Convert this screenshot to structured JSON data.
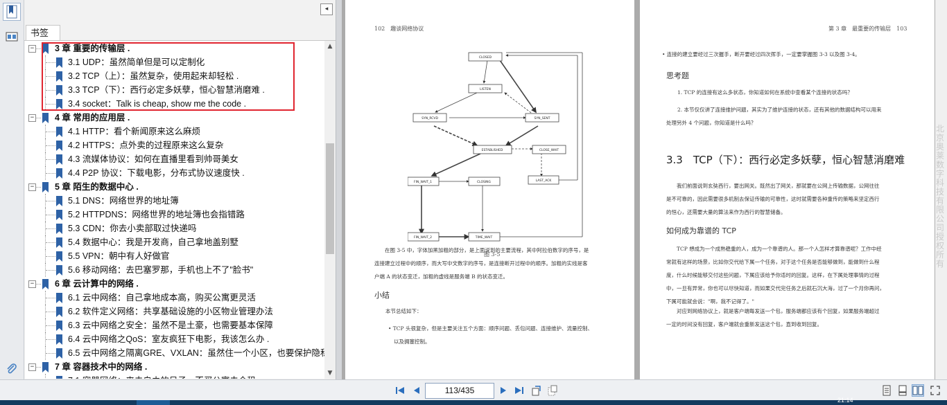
{
  "sidebar": {
    "tab_label": "书签",
    "collapse_glyph": "◂",
    "icons": [
      "bookmark-panel-icon",
      "thumbnail-panel-icon",
      "attachment-icon"
    ]
  },
  "toc": [
    {
      "level": 0,
      "label": "3 章 重要的传输层 ."
    },
    {
      "level": 1,
      "label": "3.1 UDP：虽然简单但是可以定制化"
    },
    {
      "level": 1,
      "label": "3.2 TCP（上）：虽然复杂，使用起来却轻松 ."
    },
    {
      "level": 1,
      "label": "3.3 TCP（下）：西行必定多妖孽，恒心智慧消磨难 ."
    },
    {
      "level": 1,
      "label": "3.4 socket：Talk is cheap, show me the code ."
    },
    {
      "level": 0,
      "label": "4 章 常用的应用层 ."
    },
    {
      "level": 1,
      "label": "4.1 HTTP：看个新闻原来这么麻烦"
    },
    {
      "level": 1,
      "label": "4.2 HTTPS：点外卖的过程原来这么复杂"
    },
    {
      "level": 1,
      "label": "4.3 流媒体协议：如何在直播里看到帅哥美女"
    },
    {
      "level": 1,
      "label": "4.4 P2P 协议：下载电影，分布式协议速度快 ."
    },
    {
      "level": 0,
      "label": "5 章 陌生的数据中心 ."
    },
    {
      "level": 1,
      "label": "5.1 DNS：网络世界的地址簿"
    },
    {
      "level": 1,
      "label": "5.2 HTTPDNS：网络世界的地址簿也会指错路"
    },
    {
      "level": 1,
      "label": "5.3 CDN：你去小卖部取过快递吗"
    },
    {
      "level": 1,
      "label": "5.4 数据中心：我是开发商，自己拿地盖别墅"
    },
    {
      "level": 1,
      "label": "5.5 VPN：朝中有人好做官"
    },
    {
      "level": 1,
      "label": "5.6 移动网络：去巴塞罗那，手机也上不了\"脸书\""
    },
    {
      "level": 0,
      "label": "6 章 云计算中的网络 ."
    },
    {
      "level": 1,
      "label": "6.1 云中网络：自己拿地成本高，购买公寓更灵活"
    },
    {
      "level": 1,
      "label": "6.2 软件定义网络：共享基础设施的小区物业管理办法"
    },
    {
      "level": 1,
      "label": "6.3 云中网络之安全：虽然不是土豪，也需要基本保障"
    },
    {
      "level": 1,
      "label": "6.4 云中网络之QoS：室友疯狂下电影，我该怎么办 ."
    },
    {
      "level": 1,
      "label": "6.5 云中网络之隔离GRE、VXLAN：虽然住一个小区，也要保护隐私"
    },
    {
      "level": 0,
      "label": "7 章 容器技术中的网络 ."
    },
    {
      "level": 1,
      "label": "7.1 容器网络：来去自由的日子，不买公寓去合租"
    }
  ],
  "page_left": {
    "header": "102　趣谈网络协议",
    "figure_caption": "图 3-5",
    "para1": [
      "在图 3-5 中，字体加黑加粗的部分，是上面说到的主要流程，其中阿拉伯数字的序号，是",
      "连接建立过程中的顺序，而大写中文数字的序号，是连接断开过程中的顺序。加粗的实线是客",
      "户端 A 的状态变迁，加粗的虚线是服务端 B 的状态变迁。"
    ],
    "section": "小结",
    "summary_intro": "本节总结如下：",
    "bullet": [
      "• TCP 头很复杂，但是主要关注五个方面：顺序问题、丢包问题、连接维护、流量控制、",
      "以及拥塞控制。"
    ]
  },
  "page_right": {
    "header": "第 3 章　最重要的传输层　103",
    "bullet": "• 连接的建立要经过三次握手，断开要经过四次挥手，一定要掌握图 3-3 以及图 3-4。",
    "think_title": "思考题",
    "q1": "1. TCP 的连接有这么多状态，你知道如何在系统中查看某个连接的状态吗？",
    "q2": [
      "2. 本节仅仅讲了连接维护问题，其实为了维护连接的状态，还有其他的数据结构可以用来",
      "处理另外 4 个问题，你知道是什么吗？"
    ],
    "h2": "3.3　TCP（下）：西行必定多妖孽，恒心智慧消磨难",
    "p1": [
      "我们前面说到玄奘西行，要出网关。既然出了网关，那就要在公网上传输数据，公网往往",
      "是不可靠的，因此需要很多机制去保证传输的可靠性，这时就需要各种重传的策略来坚定西行",
      "的恒心，还需要大量的算法来作为西行的智慧储备。"
    ],
    "h3": "如何成为靠谱的 TCP",
    "p2": [
      "TCP 想成为一个成熟稳重的人，成为一个靠谱的人。那一个人怎样才算靠谱呢？工作中经",
      "常就有这样的场景，比如你交代给下属一个任务，对于这个任务是否能够做到，能做到什么程",
      "度，什么时候能够交付这些问题，下属应该给予你适时的回复。这样，在下属处理事情的过程",
      "中，一旦有异常，你也可以尽快知道，而如果交代完任务之后就石沉大海，过了一个月你再问，",
      "下属可能就会说：\"啊，我不记得了。\""
    ],
    "p3": [
      "对应到网络协议上，就是客户端每发送一个包，服务端都应该有个回复，如果服务端超过",
      "一定的时间没有回复，客户端就会重新发送这个包，直到收到回复。"
    ]
  },
  "diagram": {
    "states": [
      "CLOSED",
      "LISTEN",
      "SYN_RCVD",
      "SYN_SENT",
      "ESTABLISHED",
      "CLOSE_WAIT",
      "FIN_WAIT_1",
      "CLOSING",
      "LAST_ACK",
      "FIN_WAIT_2",
      "TIME_WAIT"
    ]
  },
  "watermark": "北京奥莱数字科技有限公司授权所有",
  "navbar": {
    "page_display": "113/435",
    "buttons": [
      "first-page",
      "prev-page",
      "next-page",
      "last-page",
      "rotate",
      "extract"
    ]
  },
  "taskbar": {
    "clock": "21:14"
  }
}
